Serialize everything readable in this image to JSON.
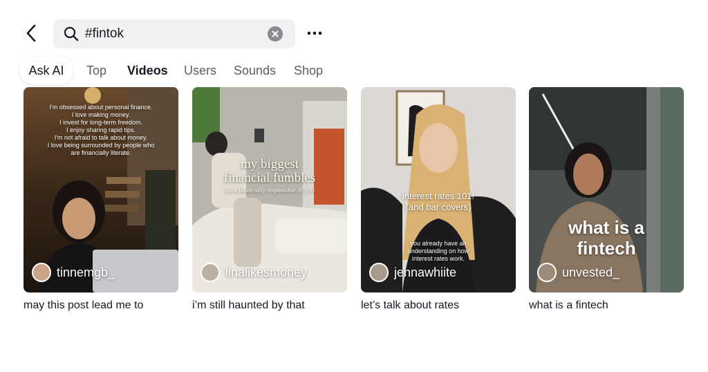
{
  "search": {
    "query": "#fintok"
  },
  "tabs": [
    {
      "label": "Ask AI"
    },
    {
      "label": "Top"
    },
    {
      "label": "Videos"
    },
    {
      "label": "Users"
    },
    {
      "label": "Sounds"
    },
    {
      "label": "Shop"
    }
  ],
  "active_tab": "Videos",
  "videos": [
    {
      "author": "tinnemgb_",
      "caption": "may this post lead me to",
      "overlay_lines": [
        "I'm obsessed about personal finance.",
        "I love making money.",
        "I invest for long-term freedom.",
        "I enjoy sharing rapid tips.",
        "I'm not afraid to talk about money.",
        "I love being surrounded by people who",
        "are financially literate."
      ]
    },
    {
      "author": "linalikesmoney",
      "caption": "i’m still haunted by that",
      "overlay_title": [
        "my biggest",
        "financial fumbles"
      ],
      "overlay_sub": "(as a financially responsible 30 y/o)"
    },
    {
      "author": "jennawhiite",
      "caption": "let’s talk about rates",
      "overlay_title": [
        "interest rates 101!",
        "(and bar covers)"
      ],
      "overlay_sub": [
        "you already have an",
        "understanding on how",
        "interest rates work."
      ]
    },
    {
      "author": "unvested_",
      "caption": "what is a fintech",
      "overlay_title": [
        "what is a",
        "fintech"
      ]
    }
  ],
  "colors": {
    "text_primary": "#161823",
    "text_secondary": "#5c5d64",
    "search_bg": "#f1f1f2"
  }
}
